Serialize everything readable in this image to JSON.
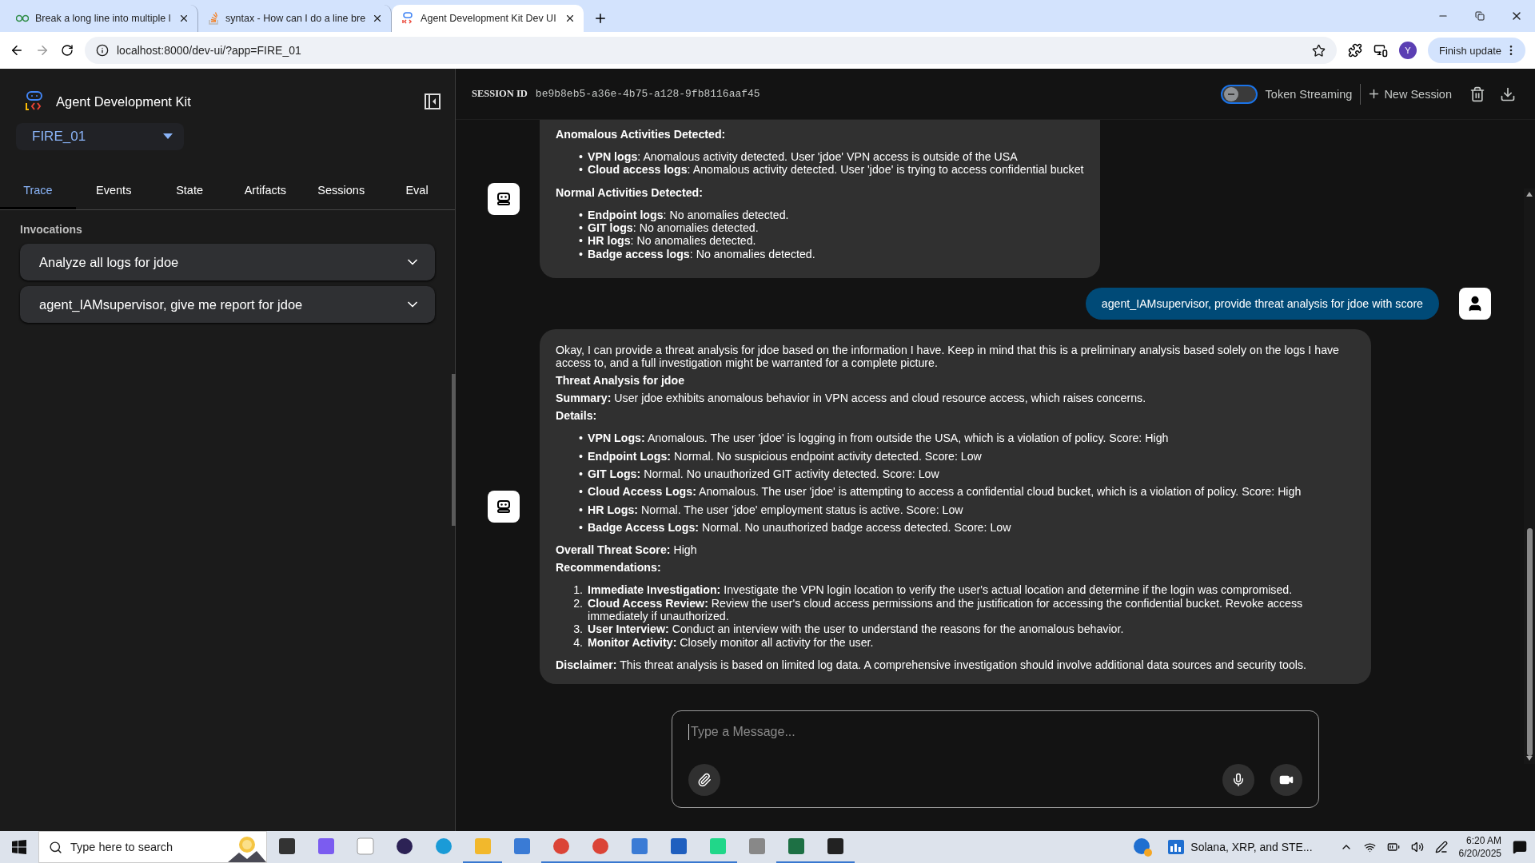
{
  "browser": {
    "tabs": [
      {
        "title": "Break a long line into multiple l",
        "selected": false,
        "kind": "geeks"
      },
      {
        "title": "syntax - How can I do a line bre",
        "selected": false,
        "kind": "stack"
      },
      {
        "title": "Agent Development Kit Dev UI",
        "selected": true,
        "kind": "adk"
      }
    ],
    "url": "localhost:8000/dev-ui/?app=FIRE_01",
    "profile": "Y",
    "update_button": "Finish update"
  },
  "sidebar": {
    "title": "Agent Development Kit",
    "app_selector": "FIRE_01",
    "tabs": [
      {
        "label": "Trace",
        "selected": true
      },
      {
        "label": "Events",
        "selected": false
      },
      {
        "label": "State",
        "selected": false
      },
      {
        "label": "Artifacts",
        "selected": false
      },
      {
        "label": "Sessions",
        "selected": false
      },
      {
        "label": "Eval",
        "selected": false
      }
    ],
    "invocations_heading": "Invocations",
    "invocations": [
      {
        "label": "Analyze all logs for jdoe",
        "expanded": false
      },
      {
        "label": "agent_IAMsupervisor, give me report for jdoe",
        "expanded": false
      }
    ]
  },
  "header": {
    "session_label": "SESSION ID",
    "session_id": "be9b8eb5-a36e-4b75-a128-9fb8116aaf45",
    "token_streaming": {
      "label": "Token Streaming",
      "on": false
    },
    "new_session": "New Session"
  },
  "messages": [
    {
      "kind": "bot",
      "cut_top": true,
      "blocks": [
        {
          "kind": "heading",
          "text": "Anomalous Activities Detected:"
        },
        {
          "kind": "list",
          "spaced": false,
          "items": [
            {
              "marker": "•",
              "text": "**VPN logs**: Anomalous activity detected. User 'jdoe' VPN access is outside of the USA"
            },
            {
              "marker": "•",
              "text": "**Cloud access logs**: Anomalous activity detected. User 'jdoe' is trying to access confidential bucket"
            }
          ]
        },
        {
          "kind": "heading",
          "text": "Normal Activities Detected:"
        },
        {
          "kind": "list",
          "spaced": false,
          "items": [
            {
              "marker": "•",
              "text": "**Endpoint logs**: No anomalies detected."
            },
            {
              "marker": "•",
              "text": "**GIT logs**: No anomalies detected."
            },
            {
              "marker": "•",
              "text": "**HR logs**: No anomalies detected."
            },
            {
              "marker": "•",
              "text": "**Badge access logs**: No anomalies detected."
            }
          ]
        }
      ]
    },
    {
      "kind": "user",
      "text": "agent_IAMsupervisor, provide threat analysis for jdoe with score"
    },
    {
      "kind": "bot",
      "cut_top": false,
      "blocks": [
        {
          "kind": "para",
          "text": "Okay, I can provide a threat analysis for jdoe based on the information I have. Keep in mind that this is a preliminary analysis based solely on the logs I have access to, and a full investigation might be warranted for a complete picture."
        },
        {
          "kind": "heading",
          "text": "Threat Analysis for jdoe"
        },
        {
          "kind": "para",
          "text": "**Summary:** User jdoe exhibits anomalous behavior in VPN access and cloud resource access, which raises concerns."
        },
        {
          "kind": "heading",
          "text": "Details:"
        },
        {
          "kind": "list",
          "spaced": true,
          "items": [
            {
              "marker": "•",
              "text": "**VPN Logs:** Anomalous. The user 'jdoe' is logging in from outside the USA, which is a violation of policy. Score: High"
            },
            {
              "marker": "•",
              "text": "**Endpoint Logs:** Normal. No suspicious endpoint activity detected. Score: Low"
            },
            {
              "marker": "•",
              "text": "**GIT Logs:** Normal. No unauthorized GIT activity detected. Score: Low"
            },
            {
              "marker": "•",
              "text": "**Cloud Access Logs:** Anomalous. The user 'jdoe' is attempting to access a confidential cloud bucket, which is a violation of policy. Score: High"
            },
            {
              "marker": "•",
              "text": "**HR Logs:** Normal. The user 'jdoe' employment status is active. Score: Low"
            },
            {
              "marker": "•",
              "text": "**Badge Access Logs:** Normal. No unauthorized badge access detected. Score: Low"
            }
          ]
        },
        {
          "kind": "para",
          "text": "**Overall Threat Score:** High"
        },
        {
          "kind": "heading",
          "text": "Recommendations:"
        },
        {
          "kind": "list",
          "spaced": false,
          "items": [
            {
              "marker": "1.",
              "text": "**Immediate Investigation:** Investigate the VPN login location to verify the user's actual location and determine if the login was compromised."
            },
            {
              "marker": "2.",
              "text": "**Cloud Access Review:** Review the user's cloud access permissions and the justification for accessing the confidential bucket. Revoke access immediately if unauthorized."
            },
            {
              "marker": "3.",
              "text": "**User Interview:** Conduct an interview with the user to understand the reasons for the anomalous behavior."
            },
            {
              "marker": "4.",
              "text": "**Monitor Activity:** Closely monitor all activity for the user."
            }
          ]
        },
        {
          "kind": "para",
          "text": "**Disclaimer:** This threat analysis is based on limited log data. A comprehensive investigation should involve additional data sources and security tools."
        }
      ]
    }
  ],
  "input": {
    "placeholder": "Type a Message..."
  },
  "taskbar": {
    "search_placeholder": "Type here to search",
    "apps": [
      {
        "kind": "taskview",
        "active": false
      },
      {
        "kind": "copilot",
        "active": false
      },
      {
        "kind": "file",
        "active": false
      },
      {
        "kind": "eclipse",
        "active": false
      },
      {
        "kind": "edge",
        "active": false
      },
      {
        "kind": "folder",
        "active": true
      },
      {
        "kind": "app",
        "active": false
      },
      {
        "kind": "chrome",
        "active": true
      },
      {
        "kind": "chrome",
        "active": true
      },
      {
        "kind": "app",
        "active": true
      },
      {
        "kind": "word",
        "active": true
      },
      {
        "kind": "pycharm",
        "active": true
      },
      {
        "kind": "tex",
        "active": false
      },
      {
        "kind": "excel",
        "active": true
      },
      {
        "kind": "terminal",
        "active": true
      }
    ],
    "news": "Solana, XRP, and STE...",
    "time": "6:20 AM",
    "date": "6/20/2025"
  }
}
